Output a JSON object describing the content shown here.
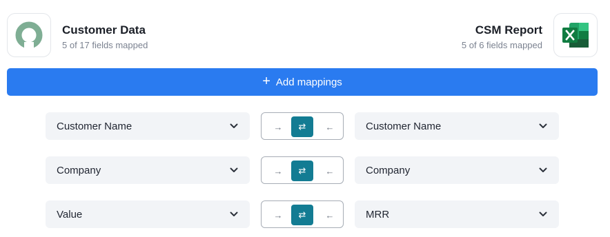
{
  "source": {
    "title": "Customer Data",
    "subtitle": "5 of 17 fields mapped",
    "logo_icon": "ring-logo-icon",
    "logo_color": "#7fae94"
  },
  "destination": {
    "title": "CSM Report",
    "subtitle": "5 of 6 fields mapped",
    "logo_icon": "excel-logo-icon",
    "logo_color": "#1e7145"
  },
  "add_button": {
    "icon": "plus-icon",
    "label": "Add mappings",
    "color": "#2a7bf0"
  },
  "direction_glyphs": {
    "to_right": "→",
    "both": "⇄",
    "to_left": "←"
  },
  "accent_color": "#137c93",
  "mappings": [
    {
      "source_field": "Customer Name",
      "target_field": "Customer Name",
      "direction": "both"
    },
    {
      "source_field": "Company",
      "target_field": "Company",
      "direction": "both"
    },
    {
      "source_field": "Value",
      "target_field": "MRR",
      "direction": "both"
    }
  ]
}
